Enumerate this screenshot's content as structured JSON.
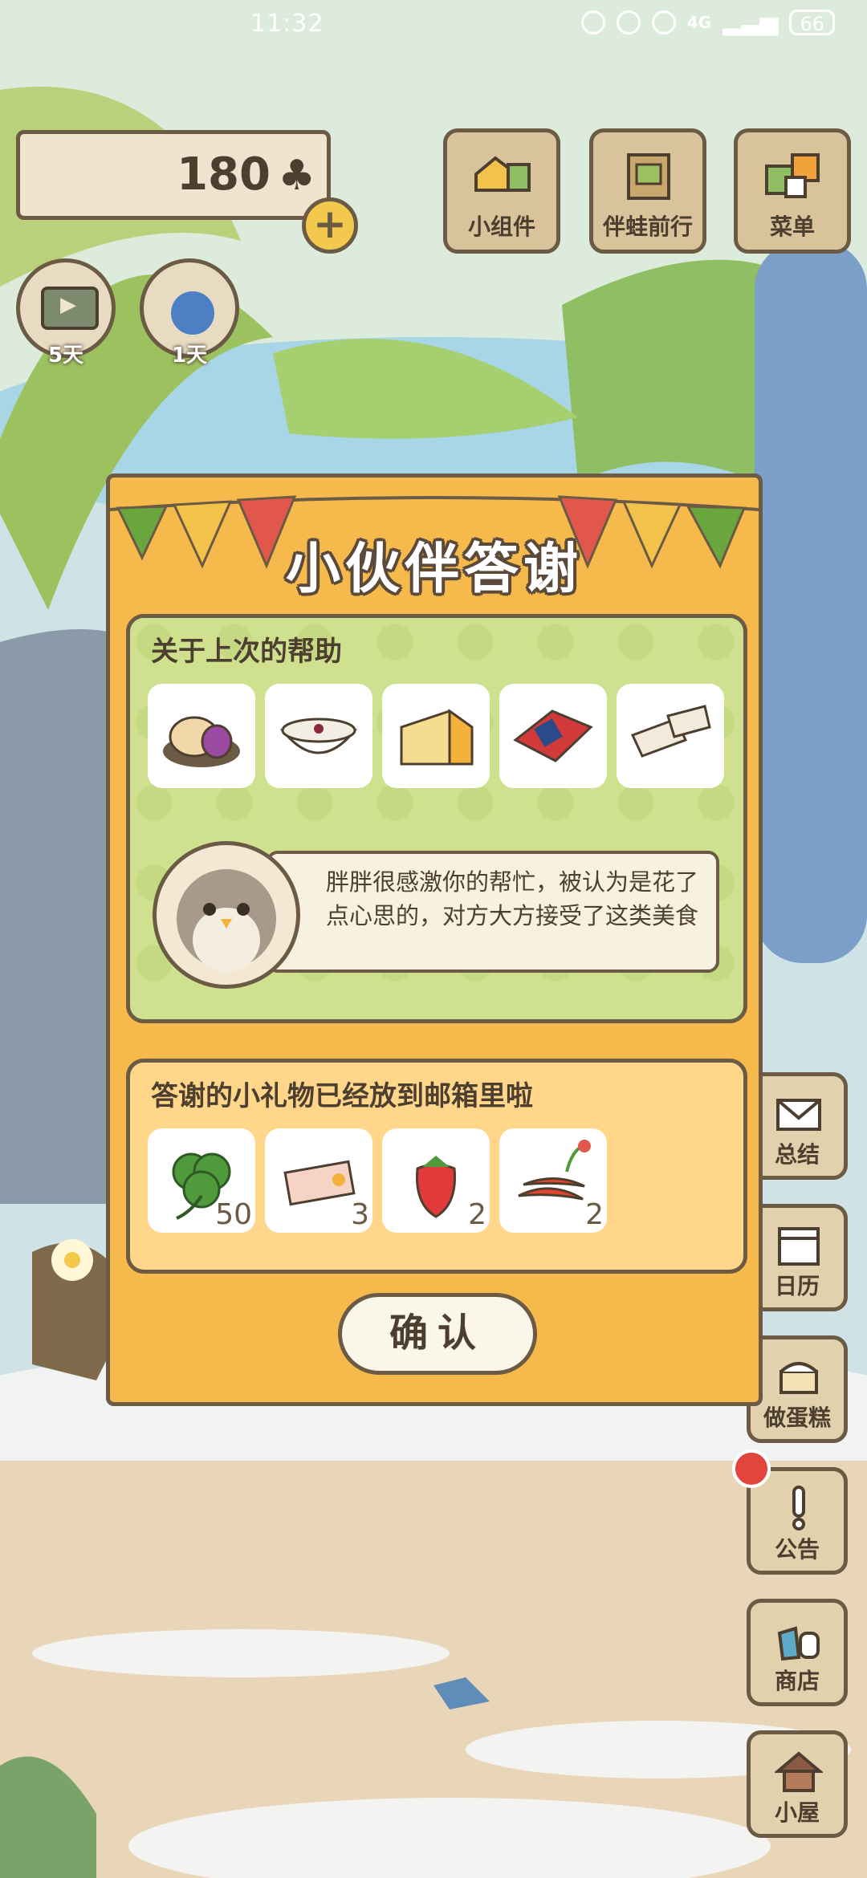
{
  "status_bar": {
    "time": "11:32",
    "battery": "66",
    "network": "4G"
  },
  "header": {
    "clover_count": "180",
    "clover_icon": "clover-icon",
    "plus_label": "+"
  },
  "timers": [
    {
      "icon": "tv-icon",
      "label": "5天"
    },
    {
      "icon": "visitor-icon",
      "label": "1天"
    }
  ],
  "top_menu": [
    {
      "icon": "widget-icon",
      "label": "小组件"
    },
    {
      "icon": "album-icon",
      "label": "伴蛙前行"
    },
    {
      "icon": "menu-icon",
      "label": "菜单"
    }
  ],
  "side_menu": [
    {
      "icon": "mail-icon",
      "label": "总结"
    },
    {
      "icon": "calendar-icon",
      "label": "日历"
    },
    {
      "icon": "cake-icon",
      "label": "做蛋糕"
    },
    {
      "icon": "notice-icon",
      "label": "公告"
    },
    {
      "icon": "shop-icon",
      "label": "商店"
    },
    {
      "icon": "house-icon",
      "label": "小屋"
    }
  ],
  "dialog": {
    "title": "小伙伴答谢",
    "section1": {
      "heading": "关于上次的帮助",
      "items": [
        {
          "name": "mooncake-icon"
        },
        {
          "name": "porridge-icon"
        },
        {
          "name": "cheese-icon"
        },
        {
          "name": "gift-box-icon"
        },
        {
          "name": "nougat-icon"
        }
      ],
      "message": "胖胖很感激你的帮忙，被认为是花了点心思的，对方大方接受了这类美食"
    },
    "section2": {
      "heading": "答谢的小礼物已经放到邮箱里啦",
      "items": [
        {
          "name": "clover-icon",
          "qty": "50"
        },
        {
          "name": "ticket-icon",
          "qty": "3"
        },
        {
          "name": "strawberry-icon",
          "qty": "2"
        },
        {
          "name": "chili-icon",
          "qty": "2"
        }
      ]
    },
    "confirm_label": "确认"
  },
  "colors": {
    "dialog_bg": "#f6b94c",
    "green_panel": "#cfe08f",
    "yellow_panel": "#ffd68a",
    "outline": "#6b5a44"
  }
}
